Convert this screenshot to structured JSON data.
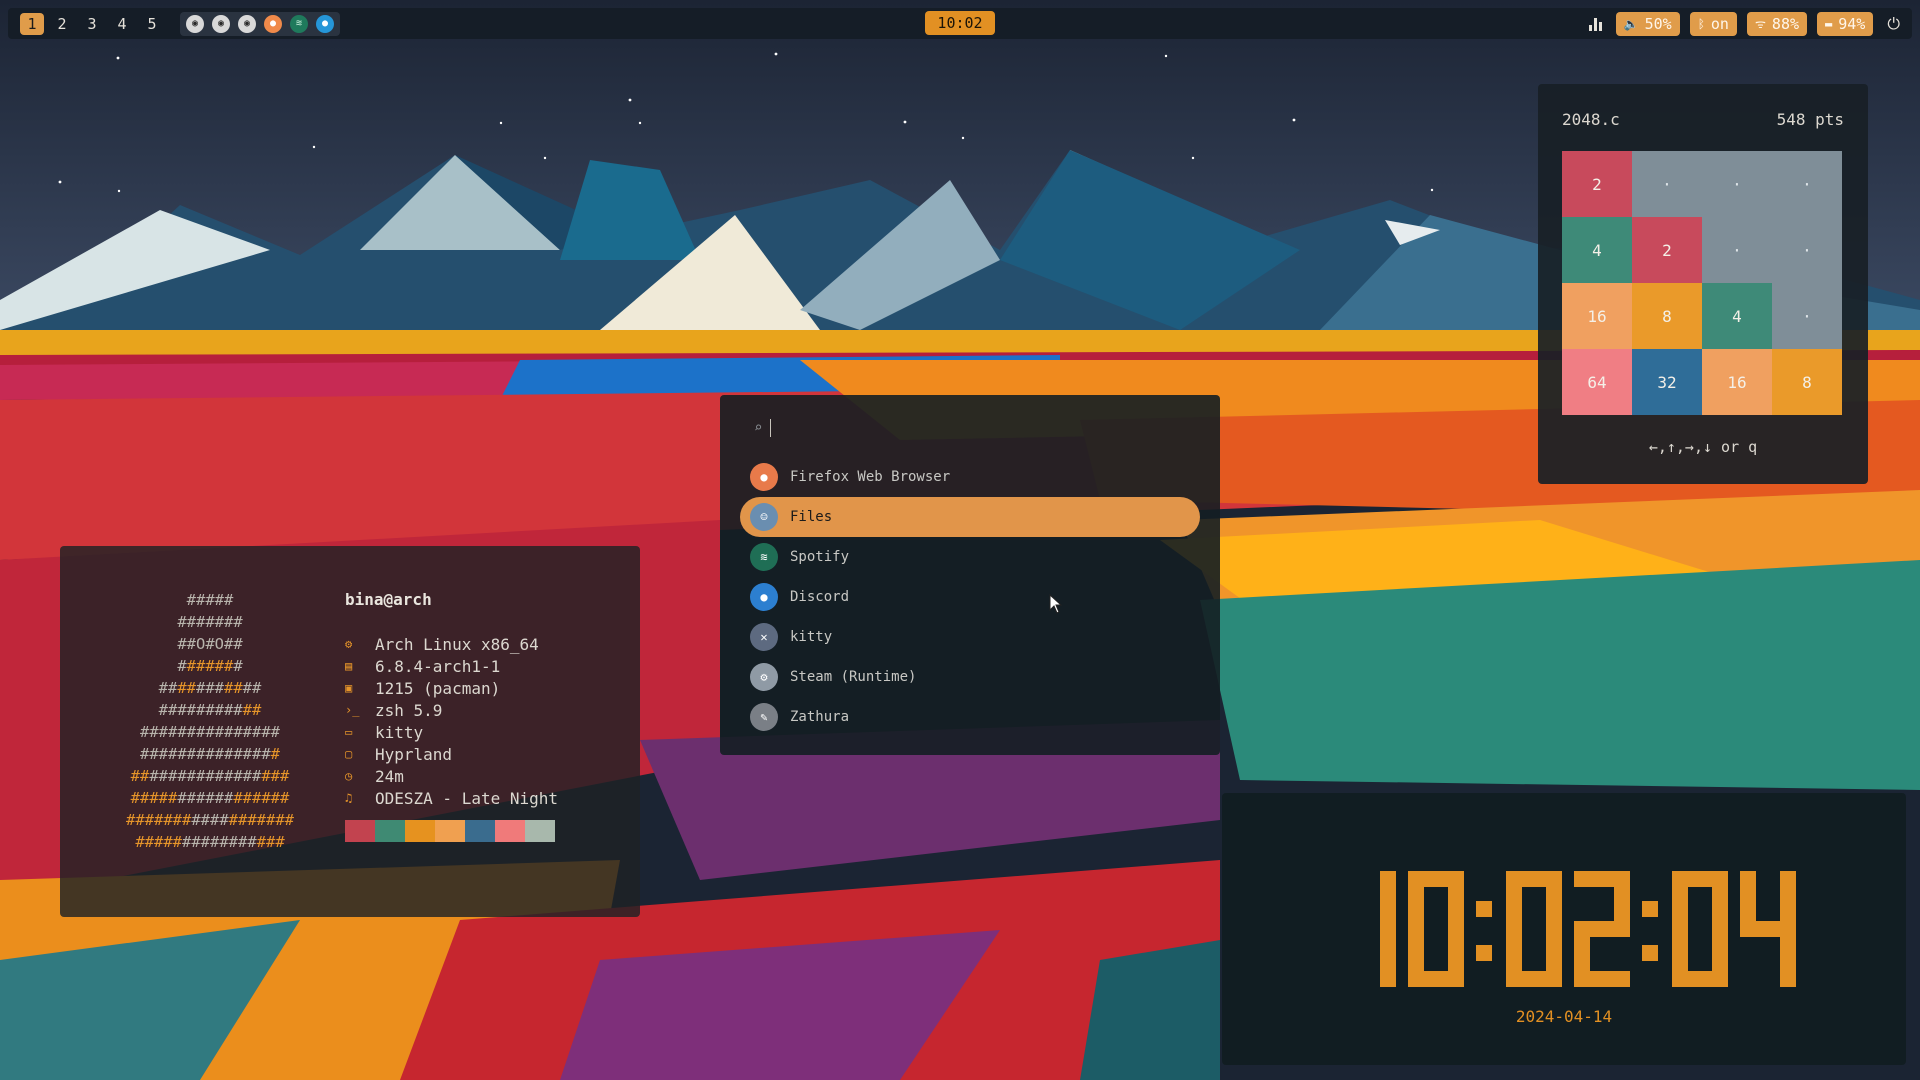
{
  "topbar": {
    "workspaces": [
      "1",
      "2",
      "3",
      "4",
      "5"
    ],
    "active_workspace": "1",
    "tray_apps": [
      "obs-icon",
      "obs-icon",
      "obs-icon",
      "firefox-icon",
      "spotify-icon",
      "discord-icon"
    ],
    "clock": "10:02",
    "volume": "50%",
    "bluetooth": "on",
    "wifi": "88%",
    "battery": "94%"
  },
  "fetch": {
    "user": "bina@arch",
    "rows": [
      {
        "icon": "gear-icon",
        "text": "Arch Linux x86_64"
      },
      {
        "icon": "chip-icon",
        "text": "6.8.4-arch1-1"
      },
      {
        "icon": "package-icon",
        "text": "1215 (pacman)"
      },
      {
        "icon": "terminal-icon",
        "text": "zsh 5.9"
      },
      {
        "icon": "window-icon",
        "text": "kitty"
      },
      {
        "icon": "desktop-icon",
        "text": "Hyprland"
      },
      {
        "icon": "clock-icon",
        "text": "24m"
      },
      {
        "icon": "music-icon",
        "text": "ODESZA - Late Night"
      }
    ],
    "palette": [
      "#c2434f",
      "#3f8a73",
      "#e6921f",
      "#f0a050",
      "#3a6c8e",
      "#f07a7a",
      "#a8b8ac"
    ]
  },
  "launcher": {
    "search_value": "",
    "apps": [
      {
        "name": "Firefox Web Browser",
        "icon": "firefox-icon",
        "selected": false
      },
      {
        "name": "Files",
        "icon": "files-icon",
        "selected": true
      },
      {
        "name": "Spotify",
        "icon": "spotify-icon",
        "selected": false
      },
      {
        "name": "Discord",
        "icon": "discord-icon",
        "selected": false
      },
      {
        "name": "kitty",
        "icon": "kitty-icon",
        "selected": false
      },
      {
        "name": "Steam (Runtime)",
        "icon": "steam-icon",
        "selected": false
      },
      {
        "name": "Zathura",
        "icon": "zathura-icon",
        "selected": false
      }
    ]
  },
  "game": {
    "title": "2048.c",
    "score": "548 pts",
    "hint": "←,↑,→,↓ or q",
    "board": [
      [
        "2",
        "·",
        "·",
        "·"
      ],
      [
        "4",
        "2",
        "·",
        "·"
      ],
      [
        "16",
        "8",
        "4",
        "·"
      ],
      [
        "64",
        "32",
        "16",
        "8"
      ]
    ],
    "tile_colors": {
      "2": "#c84a5c",
      "4": "#3e8a78",
      "8": "#ea9a2a",
      "16": "#f0a060",
      "32": "#2f6d98",
      "64": "#f07e84"
    }
  },
  "bigclock": {
    "time": "10:02:04",
    "date": "2024-04-14"
  }
}
